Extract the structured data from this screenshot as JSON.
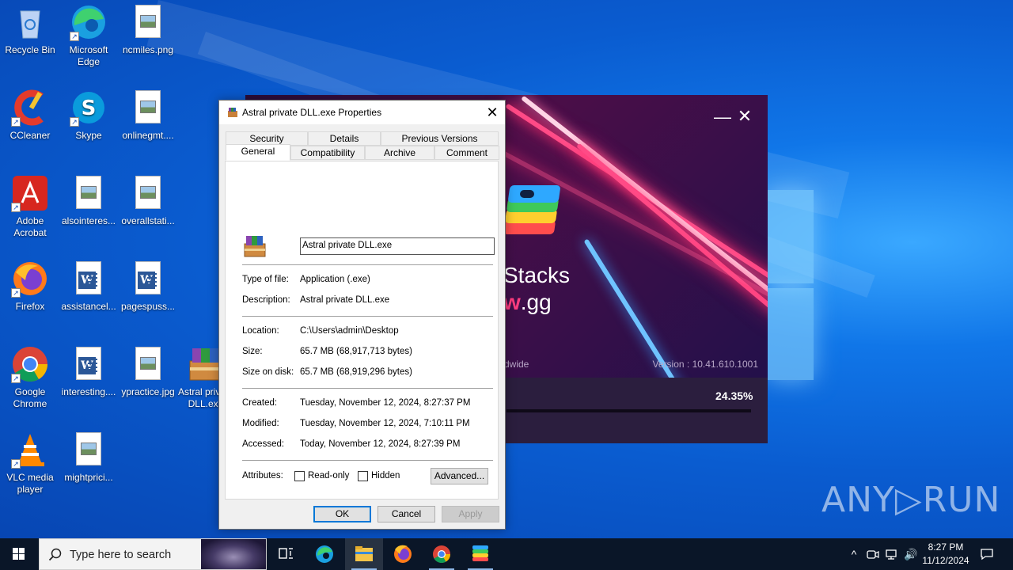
{
  "desktop_icons": [
    {
      "label": "Recycle Bin",
      "icon": "recycle-bin-icon"
    },
    {
      "label": "Microsoft Edge",
      "icon": "edge-icon"
    },
    {
      "label": "ncmiles.png",
      "icon": "image-file-icon"
    },
    {
      "label": "CCleaner",
      "icon": "ccleaner-icon"
    },
    {
      "label": "Skype",
      "icon": "skype-icon"
    },
    {
      "label": "onlinegmt....",
      "icon": "image-file-icon"
    },
    {
      "label": "Adobe Acrobat",
      "icon": "acrobat-icon"
    },
    {
      "label": "alsointeres...",
      "icon": "image-file-icon"
    },
    {
      "label": "overallstati...",
      "icon": "image-file-icon"
    },
    {
      "label": "Firefox",
      "icon": "firefox-icon"
    },
    {
      "label": "assistancel...",
      "icon": "word-doc-icon"
    },
    {
      "label": "pagespuss...",
      "icon": "word-doc-icon"
    },
    {
      "label": "Google Chrome",
      "icon": "chrome-icon"
    },
    {
      "label": "interesting....",
      "icon": "word-doc-icon"
    },
    {
      "label": "ypractice.jpg",
      "icon": "image-file-icon"
    },
    {
      "label": "Astral private DLL.exe",
      "icon": "winrar-archive-icon"
    },
    {
      "label": "VLC media player",
      "icon": "vlc-icon"
    },
    {
      "label": "mightprici...",
      "icon": "image-file-icon"
    }
  ],
  "bluestacks": {
    "brand_line1": "Stacks",
    "brand_line2_prefix": "w",
    "brand_line2_suffix": ".gg",
    "tagline_fragment": "dwide",
    "version": "Version : 10.41.610.1001",
    "progress_text": "24.35%",
    "progress_fraction": 0.2435,
    "minimize_glyph": "—",
    "close_glyph": "✕"
  },
  "dialog": {
    "title": "Astral private DLL.exe Properties",
    "close_glyph": "✕",
    "tabs_row1": [
      "Security",
      "Details",
      "Previous Versions"
    ],
    "tabs_row2": [
      "General",
      "Compatibility",
      "Archive",
      "Comment"
    ],
    "active_tab": "General",
    "file_name": "Astral private DLL.exe",
    "fields": {
      "type_label": "Type of file:",
      "type_value": "Application (.exe)",
      "description_label": "Description:",
      "description_value": "Astral private DLL.exe",
      "location_label": "Location:",
      "location_value": "C:\\Users\\admin\\Desktop",
      "size_label": "Size:",
      "size_value": "65.7 MB (68,917,713 bytes)",
      "size_on_disk_label": "Size on disk:",
      "size_on_disk_value": "65.7 MB (68,919,296 bytes)",
      "created_label": "Created:",
      "created_value": "Tuesday, November 12, 2024, 8:27:37 PM",
      "modified_label": "Modified:",
      "modified_value": "Tuesday, November 12, 2024, 7:10:11 PM",
      "accessed_label": "Accessed:",
      "accessed_value": "Today, November 12, 2024, 8:27:39 PM",
      "attributes_label": "Attributes:",
      "readonly_label": "Read-only",
      "readonly_checked": false,
      "hidden_label": "Hidden",
      "hidden_checked": false,
      "advanced_label": "Advanced..."
    },
    "buttons": {
      "ok": "OK",
      "cancel": "Cancel",
      "apply": "Apply"
    }
  },
  "watermark": "ANY▷RUN",
  "taskbar": {
    "search_placeholder": "Type here to search",
    "pinned": [
      "task-view-icon",
      "edge-icon",
      "file-explorer-icon",
      "firefox-icon",
      "chrome-icon",
      "bluestacks-icon"
    ],
    "clock_time": "8:27 PM",
    "clock_date": "11/12/2024",
    "tray_glyphs": {
      "chevron": "^",
      "speaker": "🔊",
      "notification": "🗨"
    }
  },
  "colors": {
    "accent": "#0078d7",
    "desktop_blue": "#0a5fd0",
    "bluestacks_pink": "#ff3d7f",
    "taskbar": "#0a1628"
  }
}
